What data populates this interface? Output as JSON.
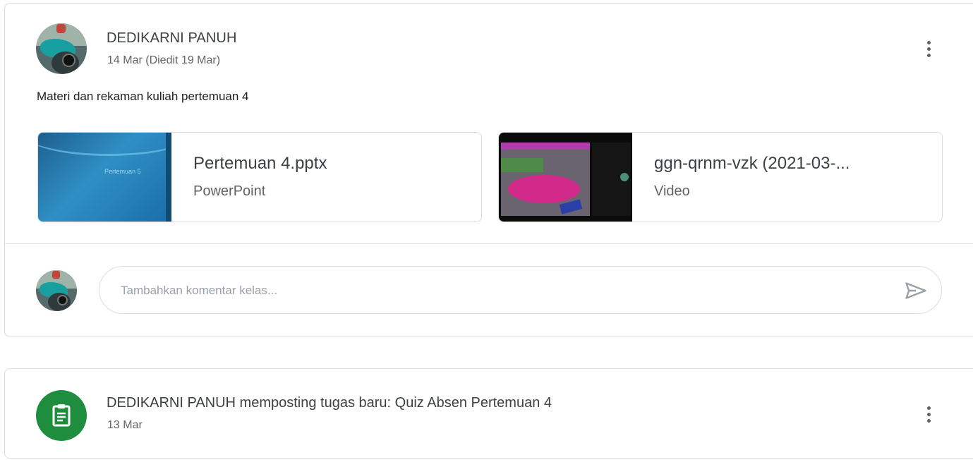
{
  "post": {
    "author": "DEDIKARNI PANUH",
    "date": "14 Mar (Diedit 19 Mar)",
    "text": "Materi dan rekaman kuliah pertemuan 4",
    "attachments": [
      {
        "title": "Pertemuan 4.pptx",
        "type": "PowerPoint",
        "thumb_text": "Pertemuan 5"
      },
      {
        "title": "ggn-qrnm-vzk (2021-03-...",
        "type": "Video"
      }
    ],
    "comment_placeholder": "Tambahkan komentar kelas..."
  },
  "assignment": {
    "title": "DEDIKARNI PANUH memposting tugas baru: Quiz Absen Pertemuan 4",
    "date": "13 Mar"
  },
  "icons": {
    "menu": "more-vert-icon",
    "send": "send-icon",
    "assignment": "assignment-icon"
  },
  "colors": {
    "assignment_green": "#1e8e3e",
    "border": "#dadce0",
    "secondary_text": "#5f6368"
  }
}
